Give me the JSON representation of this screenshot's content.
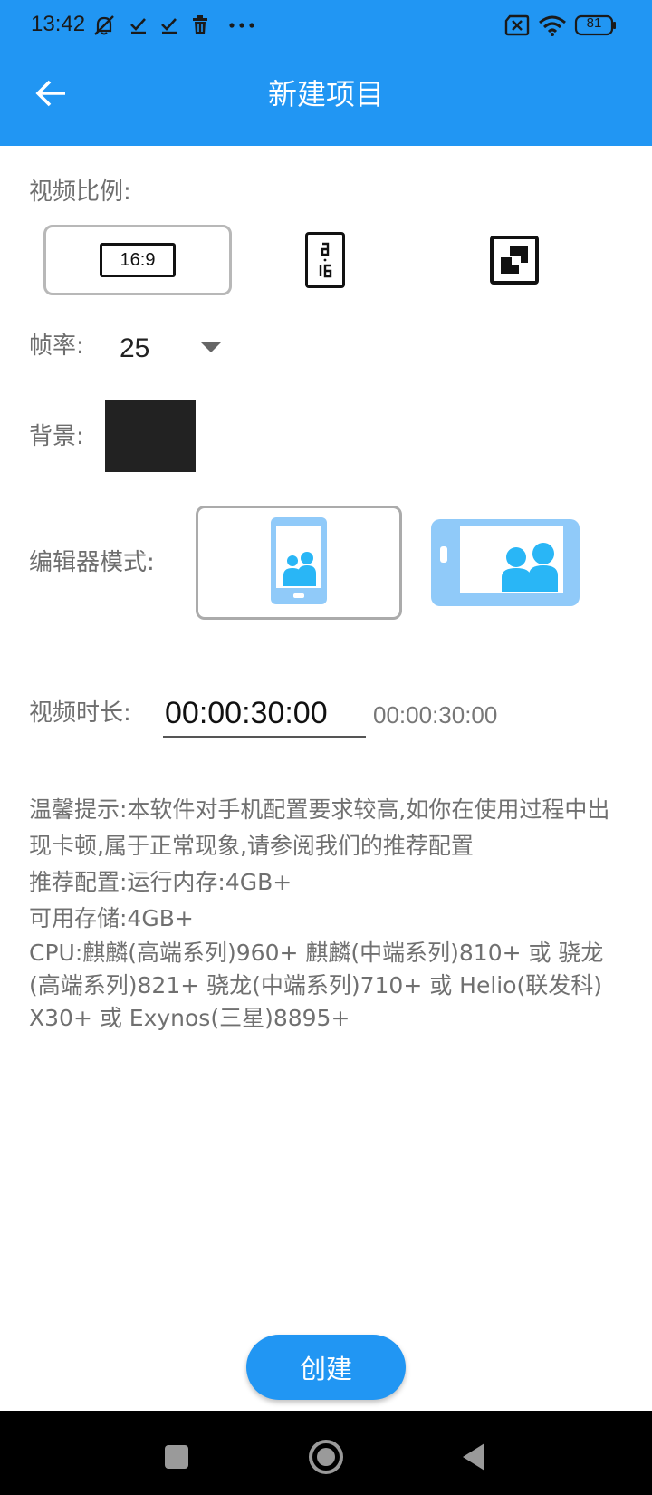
{
  "status_bar": {
    "time": "13:42",
    "icons": [
      "notifications-off-icon",
      "check-icon",
      "check-icon",
      "trash-icon",
      "more-dots-icon",
      "sim-off-icon",
      "wifi-icon",
      "battery-icon"
    ],
    "battery": "81"
  },
  "app_bar": {
    "title": "新建项目",
    "back_icon": "arrow-left-icon"
  },
  "video_ratio": {
    "label": "视频比例:",
    "options": [
      {
        "text": "16:9",
        "selected": true
      },
      {
        "text": "9:16",
        "selected": false
      },
      {
        "text": "1:1",
        "selected": false
      }
    ]
  },
  "frame_rate": {
    "label": "帧率:",
    "value": "25"
  },
  "background": {
    "label": "背景:",
    "color": "#222222"
  },
  "editor_mode": {
    "label": "编辑器模式:",
    "options": [
      {
        "name": "portrait",
        "selected": true
      },
      {
        "name": "landscape",
        "selected": false
      }
    ]
  },
  "duration": {
    "label": "视频时长:",
    "input_value": "00:00:30:00",
    "display": "00:00:30:00"
  },
  "tips": {
    "lines": [
      "温馨提示:本软件对手机配置要求较高,如你在使用过程中出现卡顿,属于正常现象,请参阅我们的推荐配置",
      "推荐配置:运行内存:4GB+",
      "可用存储:4GB+",
      " CPU:麒麟(高端系列)960+ 麒麟(中端系列)810+ 或 骁龙(高端系列)821+ 骁龙(中端系列)710+ 或 Helio(联发科) X30+ 或 Exynos(三星)8895+"
    ]
  },
  "create_button": {
    "label": "创建"
  },
  "colors": {
    "primary": "#2196f3",
    "light_primary": "#90caf9",
    "cyan": "#29b6f6"
  },
  "nav_bar": {
    "icons": [
      "recent-apps-icon",
      "home-icon",
      "back-triangle-icon"
    ]
  }
}
